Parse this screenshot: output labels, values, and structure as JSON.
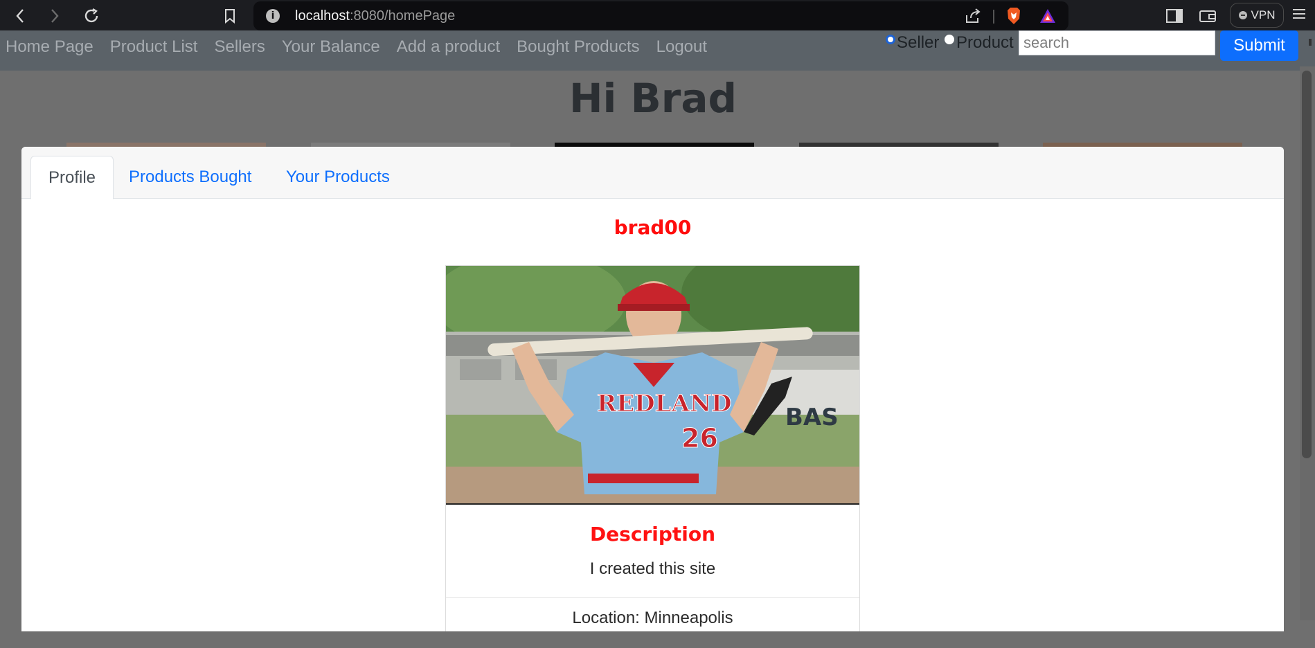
{
  "browser": {
    "url_host": "localhost",
    "url_path": ":8080/homePage",
    "vpn_label": "VPN"
  },
  "navbar": {
    "links": [
      "Home Page",
      "Product List",
      "Sellers",
      "Your Balance",
      "Add a product",
      "Bought Products",
      "Logout"
    ],
    "radio_seller": "Seller",
    "radio_product": "Product",
    "search_placeholder": "search",
    "submit_label": "Submit"
  },
  "page": {
    "greeting": "Hi Brad"
  },
  "modal": {
    "tabs": [
      "Profile",
      "Products Bought",
      "Your Products"
    ],
    "active_tab": "Profile",
    "username": "brad00",
    "description_title": "Description",
    "description_text": "I created this site",
    "location": "Location: Minneapolis"
  },
  "colors": {
    "accent": "#0d6efd",
    "highlight_red": "#ff0d0d"
  }
}
